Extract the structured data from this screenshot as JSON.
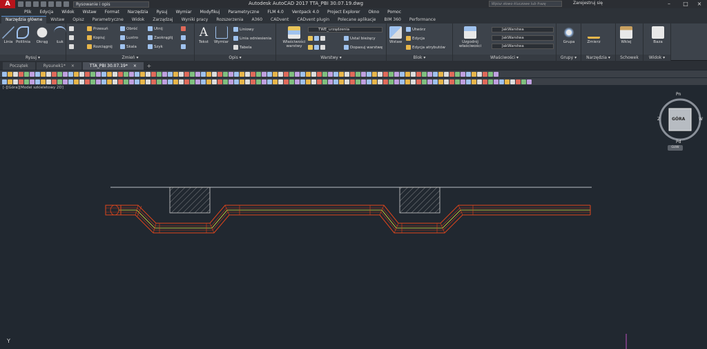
{
  "app": {
    "logo": "A",
    "title": "Autodesk AutoCAD 2017   TTA_PBI 30.07.19.dwg",
    "workspace": "Rysowanie i opis",
    "search_placeholder": "Wpisz słowo kluczowe lub frazę",
    "signin": "Zarejestruj się"
  },
  "menu": [
    "Plik",
    "Edycja",
    "Widok",
    "Wstaw",
    "Format",
    "Narzędzia",
    "Rysuj",
    "Wymiar",
    "Modyfikuj",
    "Parametryczne",
    "FLM 4.0",
    "Ventpack 4.0",
    "Project Explorer",
    "Okno",
    "Pomoc"
  ],
  "ribbon_tabs": [
    "Narzędzia główne",
    "Wstaw",
    "Opisz",
    "Parametryczne",
    "Widok",
    "Zarządzaj",
    "Wyniki pracy",
    "Rozszerzenia",
    "A360",
    "CADvent",
    "CADvent plugin",
    "Polecane aplikacje",
    "BIM 360",
    "Performance"
  ],
  "panels": {
    "rysuj": {
      "title": "Rysuj ▾",
      "tools": [
        "Linia",
        "Polilinia",
        "Okrąg",
        "Łuk"
      ]
    },
    "zmien": {
      "title": "Zmień ▾",
      "tools": [
        "Przesuń",
        "Obróć",
        "Utnij",
        "Kopiuj",
        "Lustro",
        "Zaokrąglij",
        "Rozciągnij",
        "Skala",
        "Szyk"
      ]
    },
    "opis": {
      "title": "Opis ▾",
      "tools": [
        "Tekst",
        "Wymiar",
        "Liniowy",
        "Linia odniesienia",
        "Tabela"
      ]
    },
    "warstwy": {
      "title": "Warstwy ▾",
      "big": "Właściwości warstwy",
      "layer": "TWE_urządzenia",
      "tools": [
        "Ustal bieżący",
        "Dopasuj warstwę"
      ]
    },
    "blok": {
      "title": "Blok ▾",
      "big": "Wstaw",
      "tools": [
        "Utwórz",
        "Edycja",
        "Edycja atrybutów"
      ]
    },
    "wlasciwosci": {
      "title": "Właściwości ▾",
      "big": "Uzgodnij właściwości",
      "values": [
        "JakWarstwa",
        "JakWarstwa",
        "JakWarstwa"
      ]
    },
    "grupy": {
      "title": "Grupy ▾",
      "big": "Grupa"
    },
    "narzedzia": {
      "title": "Narzędzia ▾",
      "big": "Zmierz"
    },
    "schowek": {
      "title": "Schowek",
      "big": "Wklej"
    },
    "widok": {
      "title": "Widok ▾",
      "big": "Baza"
    }
  },
  "doc_tabs": [
    {
      "label": "Początek",
      "close": ""
    },
    {
      "label": "Rysunek1*",
      "close": "×"
    },
    {
      "label": "TTA_PBI 30.07.19*",
      "close": "×"
    }
  ],
  "doc_tab_add": "+",
  "viewport_label": "[-][Góra][Model szkieletowy 2D]",
  "viewcube": {
    "face": "GÓRA",
    "north": "Pn",
    "south": "Pd",
    "east": "W",
    "west": "Z",
    "wcs": "GUW"
  },
  "ucs_label": "Y",
  "colors": {
    "accent": "#5a8fd0",
    "duct_outline": "#e0461c",
    "duct_center": "#e8e83a",
    "background": "#212830"
  }
}
